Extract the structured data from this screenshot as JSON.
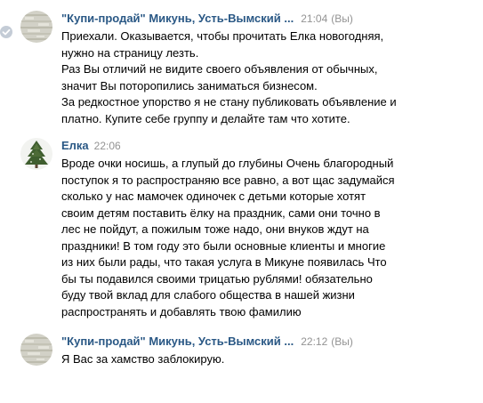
{
  "messages": [
    {
      "author": "\"Купи-продай\" Микунь, Усть-Вымский ...",
      "time": "21:04",
      "status": "(Вы)",
      "paragraphs": [
        "Приехали. Оказывается, чтобы прочитать Елка новогодняя,\nнужно на страницу лезть.",
        "Раз Вы отличий не видите своего объявления от обычных,\nзначит Вы поторопились заниматься бизнесом.",
        "За редкостное упорство я не стану публиковать объявление и\nплатно. Купите себе группу и делайте там что хотите."
      ]
    },
    {
      "author": "Елка",
      "time": "22:06",
      "paragraphs": [
        "Вроде очки носишь, а глупый до глубины Очень благородный\nпоступок я то распространяю все равно, а вот щас задумайся\nсколько у нас мамочек одиночек с детьми которые хотят\nсвоим детям поставить ёлку на праздник, сами они точно в\nлес не пойдут, а пожилым тоже надо, они внуков ждут на\nпраздники! В том году это были основные клиенты и многие\nиз них были рады, что такая услуга в Микуне появилась Что\nбы ты подавился своими трицатью рублями! обязательно\nбуду твой вклад для слабого общества в нашей жизни\nраспространять и добавлять твою фамилию"
      ]
    },
    {
      "author": "\"Купи-продай\" Микунь, Усть-Вымский ...",
      "time": "22:12",
      "status": "(Вы)",
      "paragraphs": [
        "Я Вас за хамство заблокирую."
      ]
    }
  ],
  "icons": {
    "read_check": "check-circle-icon",
    "group_avatar": "group-avatar-icon",
    "tree_avatar": "christmas-tree-avatar-icon"
  },
  "colors": {
    "author": "#2a5885",
    "time": "#939393",
    "text": "#000000",
    "read_check": "#c4ccd6"
  }
}
